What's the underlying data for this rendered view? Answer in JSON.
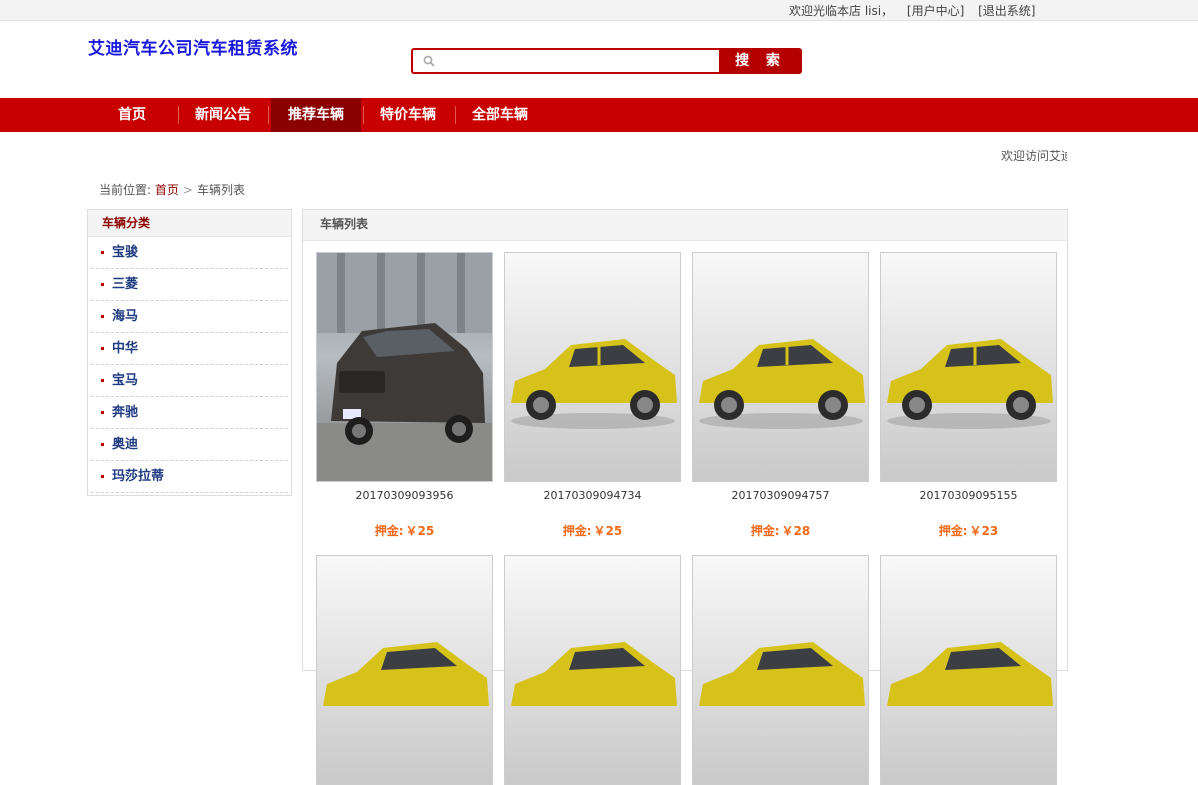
{
  "topbar": {
    "welcome": "欢迎光临本店 lisi，",
    "user_center": "[用户中心]",
    "logout": "[退出系统]"
  },
  "site": {
    "title": "艾迪汽车公司汽车租赁系统"
  },
  "search": {
    "placeholder": "",
    "button": "搜 索"
  },
  "nav": {
    "items": [
      {
        "label": "首页"
      },
      {
        "label": "新闻公告"
      },
      {
        "label": "推荐车辆"
      },
      {
        "label": "特价车辆"
      },
      {
        "label": "全部车辆"
      }
    ],
    "active_index": 2
  },
  "marquee": {
    "text": "欢迎访问艾迪"
  },
  "breadcrumb": {
    "prefix": "当前位置:",
    "home": "首页",
    "current": "车辆列表"
  },
  "sidebar": {
    "title": "车辆分类",
    "items": [
      {
        "label": "宝骏"
      },
      {
        "label": "三菱"
      },
      {
        "label": "海马"
      },
      {
        "label": "中华"
      },
      {
        "label": "宝马"
      },
      {
        "label": "奔驰"
      },
      {
        "label": "奥迪"
      },
      {
        "label": "玛莎拉蒂"
      }
    ]
  },
  "main": {
    "title": "车辆列表",
    "cars": [
      {
        "code": "20170309093956",
        "price_label": "押金:",
        "price": "￥25",
        "image": "dark-suv-photo"
      },
      {
        "code": "20170309094734",
        "price_label": "押金:",
        "price": "￥25",
        "image": "yellow-hatchback-photo"
      },
      {
        "code": "20170309094757",
        "price_label": "押金:",
        "price": "￥28",
        "image": "yellow-hatchback-photo"
      },
      {
        "code": "20170309095155",
        "price_label": "押金:",
        "price": "￥23",
        "image": "yellow-hatchback-photo"
      },
      {
        "code": "",
        "price_label": "",
        "price": "",
        "image": "yellow-hatchback-photo"
      },
      {
        "code": "",
        "price_label": "",
        "price": "",
        "image": "yellow-hatchback-photo"
      },
      {
        "code": "",
        "price_label": "",
        "price": "",
        "image": "yellow-hatchback-photo"
      },
      {
        "code": "",
        "price_label": "",
        "price": "",
        "image": "yellow-hatchback-photo"
      }
    ]
  },
  "colors": {
    "brand_red": "#c80000",
    "active_tab": "#8b0000",
    "price_orange": "#f06a1a",
    "title_blue": "#1a1adc"
  }
}
